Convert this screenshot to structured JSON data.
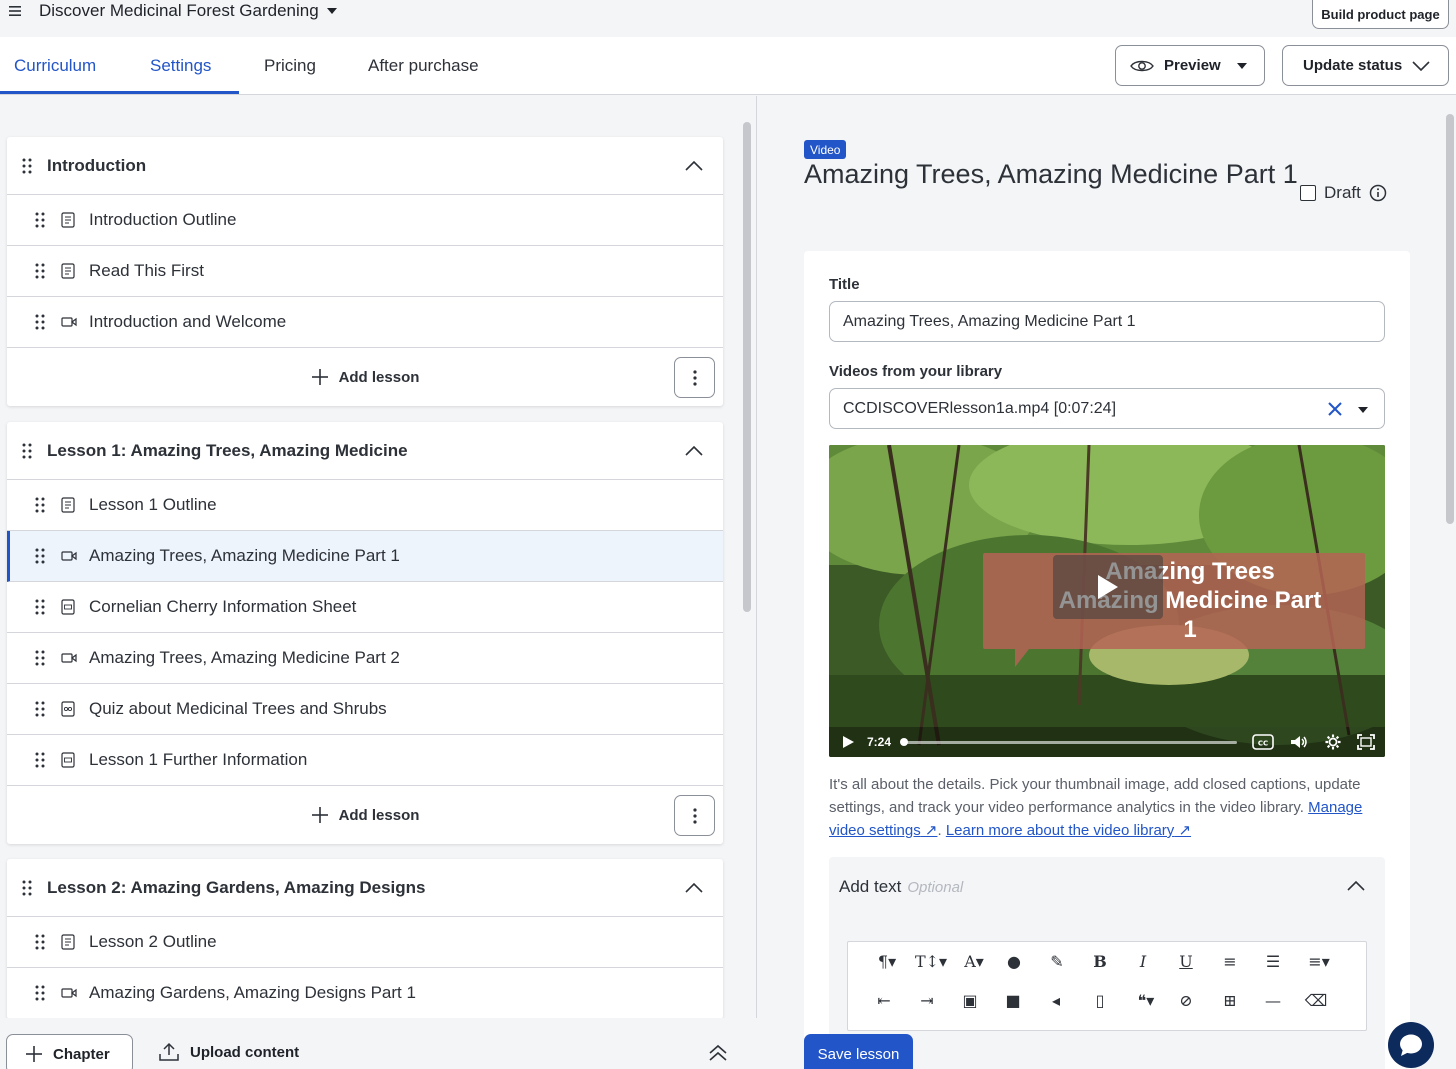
{
  "topbar": {
    "course_title": "Discover Medicinal Forest Gardening",
    "build_button": "Build product page"
  },
  "tabs": [
    {
      "label": "Curriculum"
    },
    {
      "label": "Settings"
    },
    {
      "label": "Pricing"
    },
    {
      "label": "After purchase"
    }
  ],
  "header_actions": {
    "preview": "Preview",
    "update_status": "Update status"
  },
  "chapters": [
    {
      "title": "Introduction",
      "lessons": [
        {
          "title": "Introduction Outline",
          "icon": "text-doc-icon"
        },
        {
          "title": "Read This First",
          "icon": "text-doc-icon"
        },
        {
          "title": "Introduction and Welcome",
          "icon": "video-icon"
        }
      ],
      "add_lesson": "Add lesson"
    },
    {
      "title": "Lesson 1: Amazing Trees, Amazing Medicine",
      "lessons": [
        {
          "title": "Lesson 1 Outline",
          "icon": "text-doc-icon"
        },
        {
          "title": "Amazing Trees, Amazing Medicine Part 1",
          "icon": "video-icon",
          "selected": true
        },
        {
          "title": "Cornelian Cherry Information Sheet",
          "icon": "pdf-icon"
        },
        {
          "title": "Amazing Trees, Amazing Medicine Part 2",
          "icon": "video-icon"
        },
        {
          "title": "Quiz about Medicinal Trees and Shrubs",
          "icon": "quiz-icon"
        },
        {
          "title": "Lesson 1 Further Information",
          "icon": "pdf-icon"
        }
      ],
      "add_lesson": "Add lesson"
    },
    {
      "title": "Lesson 2: Amazing Gardens, Amazing Designs",
      "lessons": [
        {
          "title": "Lesson 2 Outline",
          "icon": "text-doc-icon"
        },
        {
          "title": "Amazing Gardens, Amazing Designs Part 1",
          "icon": "video-icon"
        }
      ]
    }
  ],
  "bottombar": {
    "chapter": "Chapter",
    "upload": "Upload content"
  },
  "editor": {
    "badge": "Video",
    "heading": "Amazing Trees, Amazing Medicine Part 1",
    "draft_label": "Draft",
    "title_label": "Title",
    "title_value": "Amazing Trees, Amazing Medicine Part 1",
    "library_label": "Videos from your library",
    "library_value": "CCDISCOVERlesson1a.mp4 [0:07:24]",
    "video_overlay": "Amazing Trees Amazing Medicine Part 1",
    "video_time": "7:24",
    "help_text": "It's all about the details. Pick your thumbnail image, add closed captions, update settings, and track your video performance analytics in the video library.",
    "help_link1": "Manage video settings",
    "help_link2": "Learn more about the video library",
    "addtext_label": "Add text",
    "addtext_optional": "Optional",
    "save": "Save lesson"
  },
  "colors": {
    "accent": "#2255c8",
    "selected_bg": "#eef4fc",
    "chat_bg": "#0d2a5c"
  }
}
